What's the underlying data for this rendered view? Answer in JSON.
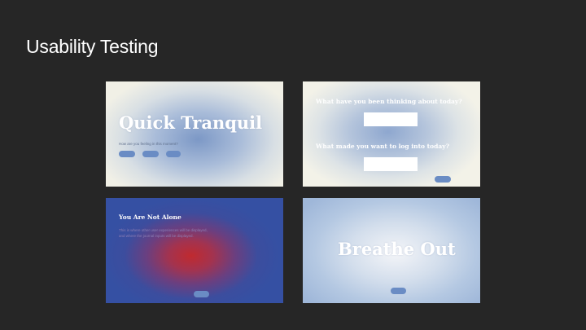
{
  "slide": {
    "title": "Usability Testing"
  },
  "screens": {
    "quick_tranquil": {
      "title": "Quick Tranquil",
      "prompt": "How are you feeling in this moment?",
      "options": [
        "",
        "",
        ""
      ]
    },
    "reflection": {
      "question1": "What have you been thinking about today?",
      "question2": "What made you want to log into today?",
      "input1_value": "",
      "input2_value": "",
      "next_label": ""
    },
    "not_alone": {
      "heading": "You Are Not Alone",
      "body": "This is where other user experiences will be displayed, and where the journal inputs will be displayed.",
      "next_label": ""
    },
    "breathe_out": {
      "title": "Breathe Out",
      "next_label": ""
    }
  },
  "colors": {
    "background": "#262626",
    "button": "#6a8cc4",
    "accent_red": "#c02a2f",
    "accent_blue": "#3550a3"
  }
}
